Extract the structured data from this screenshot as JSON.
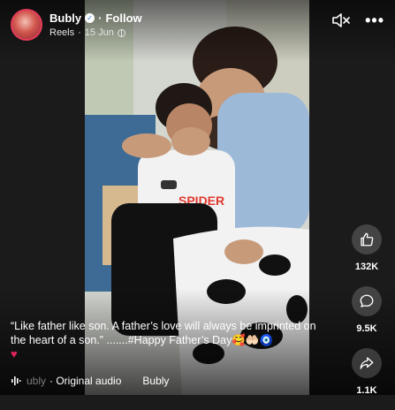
{
  "header": {
    "author": "Bubly",
    "follow_label": "Follow",
    "source": "Reels",
    "date": "15 Jun"
  },
  "actions": {
    "likes": "132K",
    "comments": "9.5K",
    "shares": "1.1K"
  },
  "caption": {
    "text": "“Like father like son. A father’s love will always be imprinted on the heart of a son.” .......#Happy Father’s Day🥰🤲🏻🧿",
    "heart": "♥"
  },
  "audio": {
    "faded_prefix": "ubly",
    "label": "· Original audio",
    "next_author": "Bubly"
  },
  "colors": {
    "accent": "#1877f2",
    "heart": "#e0245e"
  }
}
